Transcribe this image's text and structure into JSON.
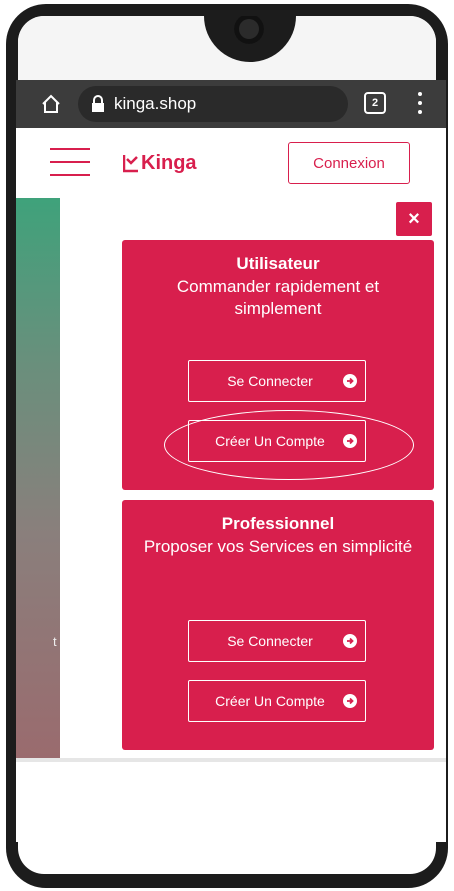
{
  "browser": {
    "url": "kinga.shop",
    "tab_count": "2"
  },
  "header": {
    "logo_text": "Kinga",
    "login_label": "Connexion"
  },
  "background": {
    "partial_letter": "t"
  },
  "modal": {
    "close_label": "×",
    "cards": [
      {
        "title": "Utilisateur",
        "subtitle": "Commander rapidement et simplement",
        "login_label": "Se Connecter",
        "create_label": "Créer Un Compte"
      },
      {
        "title": "Professionnel",
        "subtitle": "Proposer vos Services en simplicité",
        "login_label": "Se Connecter",
        "create_label": "Créer Un Compte"
      }
    ]
  },
  "colors": {
    "brand": "#d81f4d",
    "browser_bar": "#3c3c3c"
  },
  "icons": [
    "home-icon",
    "lock-icon",
    "tab-switcher-icon",
    "kebab-menu-icon",
    "hamburger-menu-icon",
    "close-icon",
    "arrow-circle-right-icon"
  ]
}
